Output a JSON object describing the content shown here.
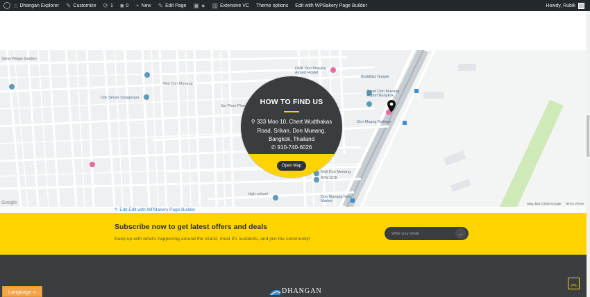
{
  "admin_bar": {
    "site_name": "Dhangan Explorer",
    "customize": "Customize",
    "revisions_count": "1",
    "comments_count": "0",
    "new": "New",
    "edit_page": "Edit Page",
    "extensive_vc": "Extensive VC",
    "theme_options": "Theme options",
    "wpbakery": "Edit with WPBakery Page Builder",
    "howdy": "Howdy, Rubik"
  },
  "map": {
    "labels": [
      {
        "text": "Sena Village Garden"
      },
      {
        "text": "City Sense Songprapa"
      },
      {
        "text": "DMK Don Mueang Airport Hostel"
      },
      {
        "text": "Buddhist Temple"
      },
      {
        "text": "Amari Don Mueang Airport Bangkok"
      },
      {
        "text": "Don Muang Railway"
      },
      {
        "text": "High school"
      },
      {
        "text": "Don Mueang New Market"
      },
      {
        "text": "Mali Don Mueang"
      },
      {
        "text": "ATM SCB"
      },
      {
        "text": "Soi Phon Phaet"
      },
      {
        "text": "Wat Don Mueang"
      }
    ],
    "google": "Google",
    "map_data": "Map data ©2018 Google",
    "terms": "Terms of Use"
  },
  "find_us": {
    "title": "HOW TO FIND US",
    "address": "333 Moo 10, Chert Wudthakas Road, Srikan, Don Mueang, Bangkok, Thailand",
    "phone": "910-740-6026",
    "button": "Open Map"
  },
  "edit_links": "Edit   Edit with WPBakery Page Builder",
  "subscribe": {
    "title": "Subscribe now to get latest offers and deals",
    "text": "Keep up with what's happening around the island, meet it's residents, and join the community!",
    "placeholder": "Write your email"
  },
  "footer": {
    "logo_text": "DHANGAN"
  },
  "language_button": "Language »",
  "colors": {
    "accent": "#fed400",
    "dark": "#3a3d40",
    "admin_bar": "#23282d",
    "language": "#f2a44a"
  }
}
